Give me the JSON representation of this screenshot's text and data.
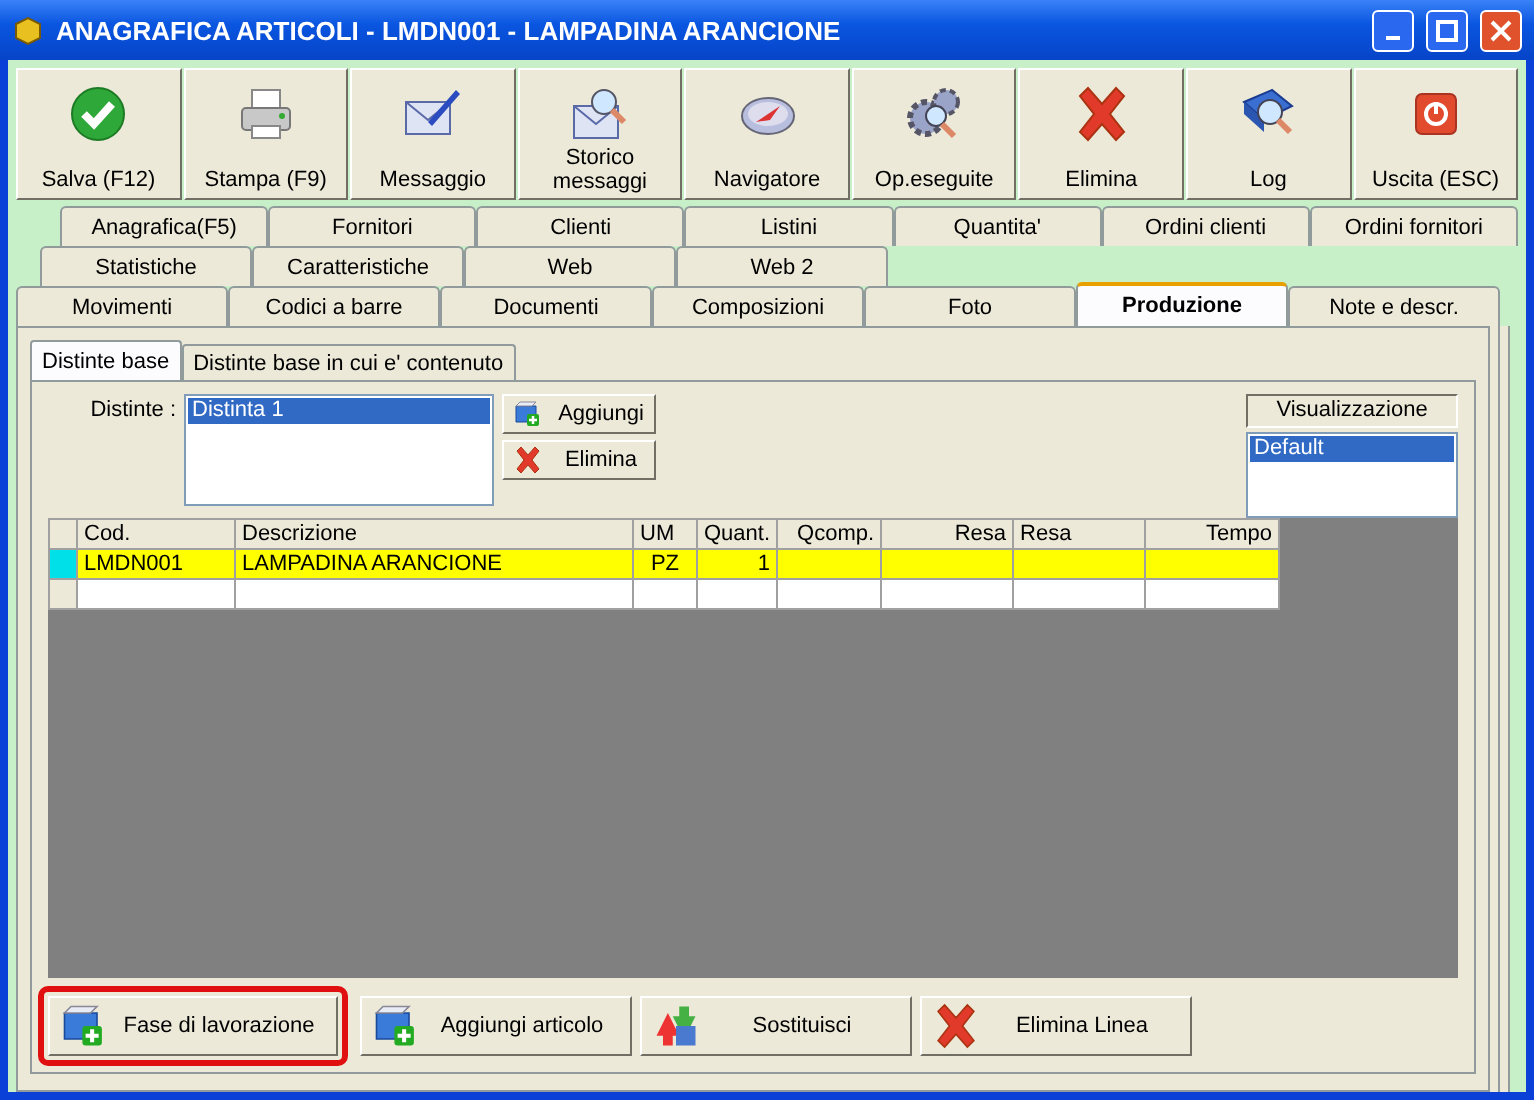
{
  "window": {
    "title": "ANAGRAFICA ARTICOLI - LMDN001 - LAMPADINA ARANCIONE"
  },
  "toolbar": [
    {
      "label": "Salva (F12)",
      "kind": "check"
    },
    {
      "label": "Stampa (F9)",
      "kind": "printer"
    },
    {
      "label": "Messaggio",
      "kind": "envelope-pen"
    },
    {
      "label": "Storico messaggi",
      "kind": "envelope-search"
    },
    {
      "label": "Navigatore",
      "kind": "compass"
    },
    {
      "label": "Op.eseguite",
      "kind": "gears"
    },
    {
      "label": "Elimina",
      "kind": "cross"
    },
    {
      "label": "Log",
      "kind": "book-search"
    },
    {
      "label": "Uscita (ESC)",
      "kind": "power"
    }
  ],
  "tab_rows": [
    [
      {
        "label": "Anagrafica(F5)",
        "selected": false
      },
      {
        "label": "Fornitori",
        "selected": false
      },
      {
        "label": "Clienti",
        "selected": false
      },
      {
        "label": "Listini",
        "selected": false
      },
      {
        "label": "Quantita'",
        "selected": false
      },
      {
        "label": "Ordini clienti",
        "selected": false
      },
      {
        "label": "Ordini fornitori",
        "selected": false
      }
    ],
    [
      {
        "label": "Statistiche",
        "selected": false
      },
      {
        "label": "Caratteristiche",
        "selected": false
      },
      {
        "label": "Web",
        "selected": false
      },
      {
        "label": "Web 2",
        "selected": false
      }
    ],
    [
      {
        "label": "Movimenti",
        "selected": false
      },
      {
        "label": "Codici a barre",
        "selected": false
      },
      {
        "label": "Documenti",
        "selected": false
      },
      {
        "label": "Composizioni",
        "selected": false
      },
      {
        "label": "Foto",
        "selected": false
      },
      {
        "label": "Produzione",
        "selected": true
      },
      {
        "label": "Note e descr.",
        "selected": false
      }
    ]
  ],
  "subtabs": [
    {
      "label": "Distinte base",
      "selected": true
    },
    {
      "label": "Distinte base in cui e' contenuto",
      "selected": false
    }
  ],
  "distinte": {
    "label": "Distinte :",
    "items": [
      {
        "label": "Distinta 1",
        "selected": true
      }
    ],
    "buttons": [
      {
        "label": "Aggiungi",
        "kind": "add"
      },
      {
        "label": "Elimina",
        "kind": "cross"
      }
    ]
  },
  "visualizzazione": {
    "title": "Visualizzazione",
    "items": [
      {
        "label": "Default",
        "selected": true
      }
    ]
  },
  "grid": {
    "columns": [
      "Cod.",
      "Descrizione",
      "UM",
      "Quant.",
      "Qcomp.",
      "Resa",
      "Resa",
      "Tempo"
    ],
    "rows": [
      {
        "selected": true,
        "cells": [
          "LMDN001",
          "LAMPADINA ARANCIONE",
          "PZ",
          "1"
        ]
      },
      {
        "selected": false
      }
    ]
  },
  "bottom_buttons": [
    {
      "label": "Fase di lavorazione",
      "kind": "add",
      "highlighted": true
    },
    {
      "label": "Aggiungi articolo",
      "kind": "add",
      "highlighted": false
    },
    {
      "label": "Sostituisci",
      "kind": "swap",
      "highlighted": false
    },
    {
      "label": "Elimina Linea",
      "kind": "cross",
      "highlighted": false
    }
  ]
}
